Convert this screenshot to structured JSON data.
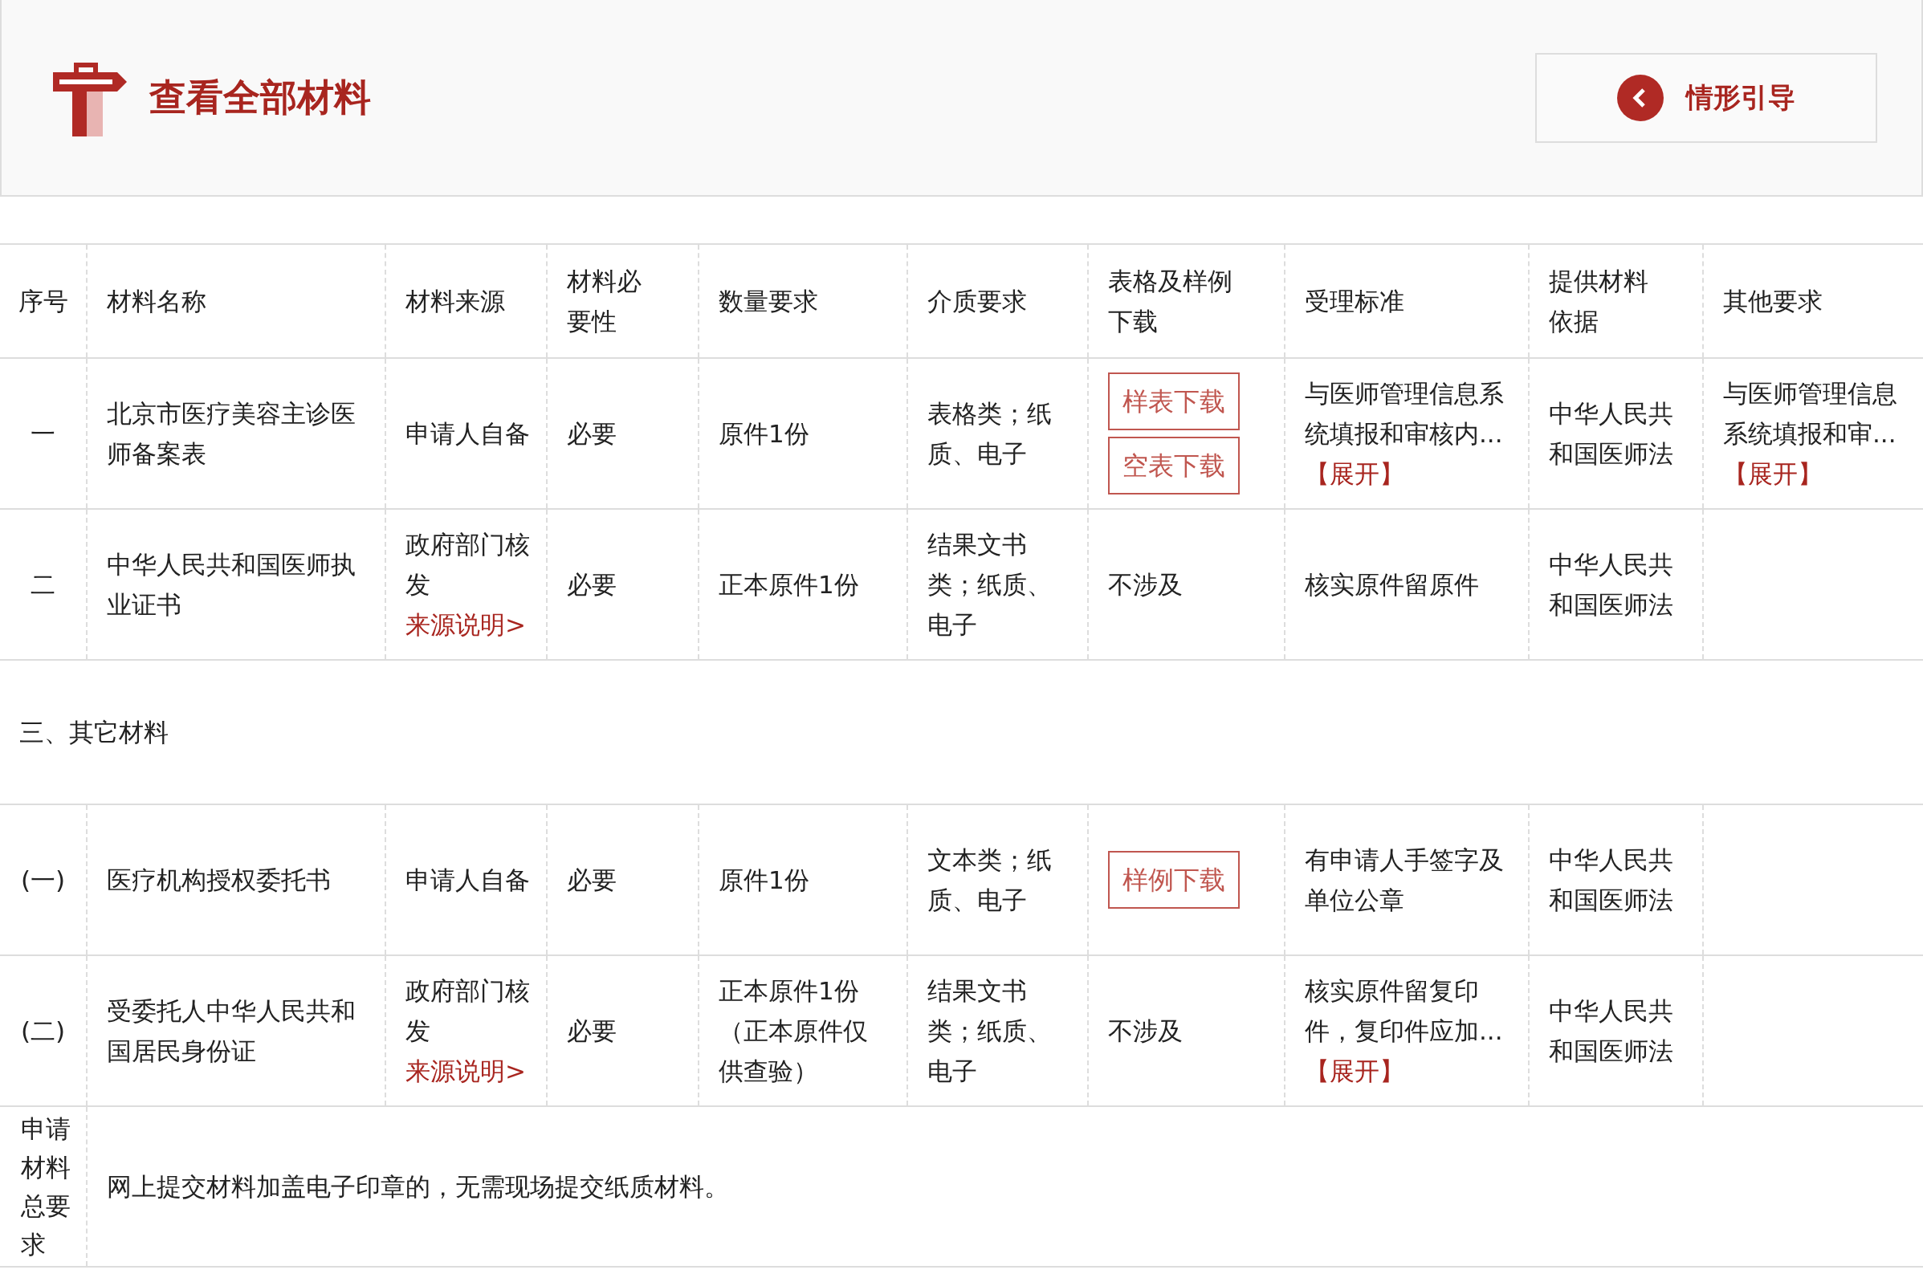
{
  "header": {
    "title": "查看全部材料",
    "guide_button": "情形引导"
  },
  "table": {
    "columns": [
      "序号",
      "材料名称",
      "材料来源",
      "材料必要性",
      "数量要求",
      "介质要求",
      "表格及样例下载",
      "受理标准",
      "提供材料依据",
      "其他要求"
    ],
    "rows": [
      {
        "kind": "material",
        "index": "一",
        "name": "北京市医疗美容主诊医师备案表",
        "source": "申请人自备",
        "necessity": "必要",
        "quantity": "原件1份",
        "medium": "表格类；纸质、电子",
        "downloads": [
          "样表下载",
          "空表下载"
        ],
        "standard": "与医师管理信息系统填报和审核内...",
        "standard_link": "【展开】",
        "basis": "中华人民共和国医师法",
        "other": "与医师管理信息系统填报和审...",
        "other_link": "【展开】"
      },
      {
        "kind": "material",
        "index": "二",
        "name": "中华人民共和国医师执业证书",
        "source": "政府部门核发",
        "source_link": "来源说明>",
        "necessity": "必要",
        "quantity": "正本原件1份",
        "medium": "结果文书类；纸质、电子",
        "form_text": "不涉及",
        "standard": "核实原件留原件",
        "basis": "中华人民共和国医师法"
      },
      {
        "kind": "section",
        "label": "三、其它材料"
      },
      {
        "kind": "material",
        "index": "(一)",
        "name": "医疗机构授权委托书",
        "source": "申请人自备",
        "necessity": "必要",
        "quantity": "原件1份",
        "medium": "文本类；纸质、电子",
        "downloads": [
          "样例下载"
        ],
        "standard": "有申请人手签字及单位公章",
        "basis": "中华人民共和国医师法"
      },
      {
        "kind": "material",
        "index": "(二)",
        "name": "受委托人中华人民共和国居民身份证",
        "source": "政府部门核发",
        "source_link": "来源说明>",
        "necessity": "必要",
        "quantity": "正本原件1份（正本原件仅供查验）",
        "medium": "结果文书类；纸质、电子",
        "form_text": "不涉及",
        "standard": "核实原件留复印件，复印件应加...",
        "standard_link": "【展开】",
        "basis": "中华人民共和国医师法"
      }
    ]
  },
  "summary": {
    "label": "申请材料总要求",
    "text": "网上提交材料加盖电子印章的，无需现场提交纸质材料。"
  }
}
